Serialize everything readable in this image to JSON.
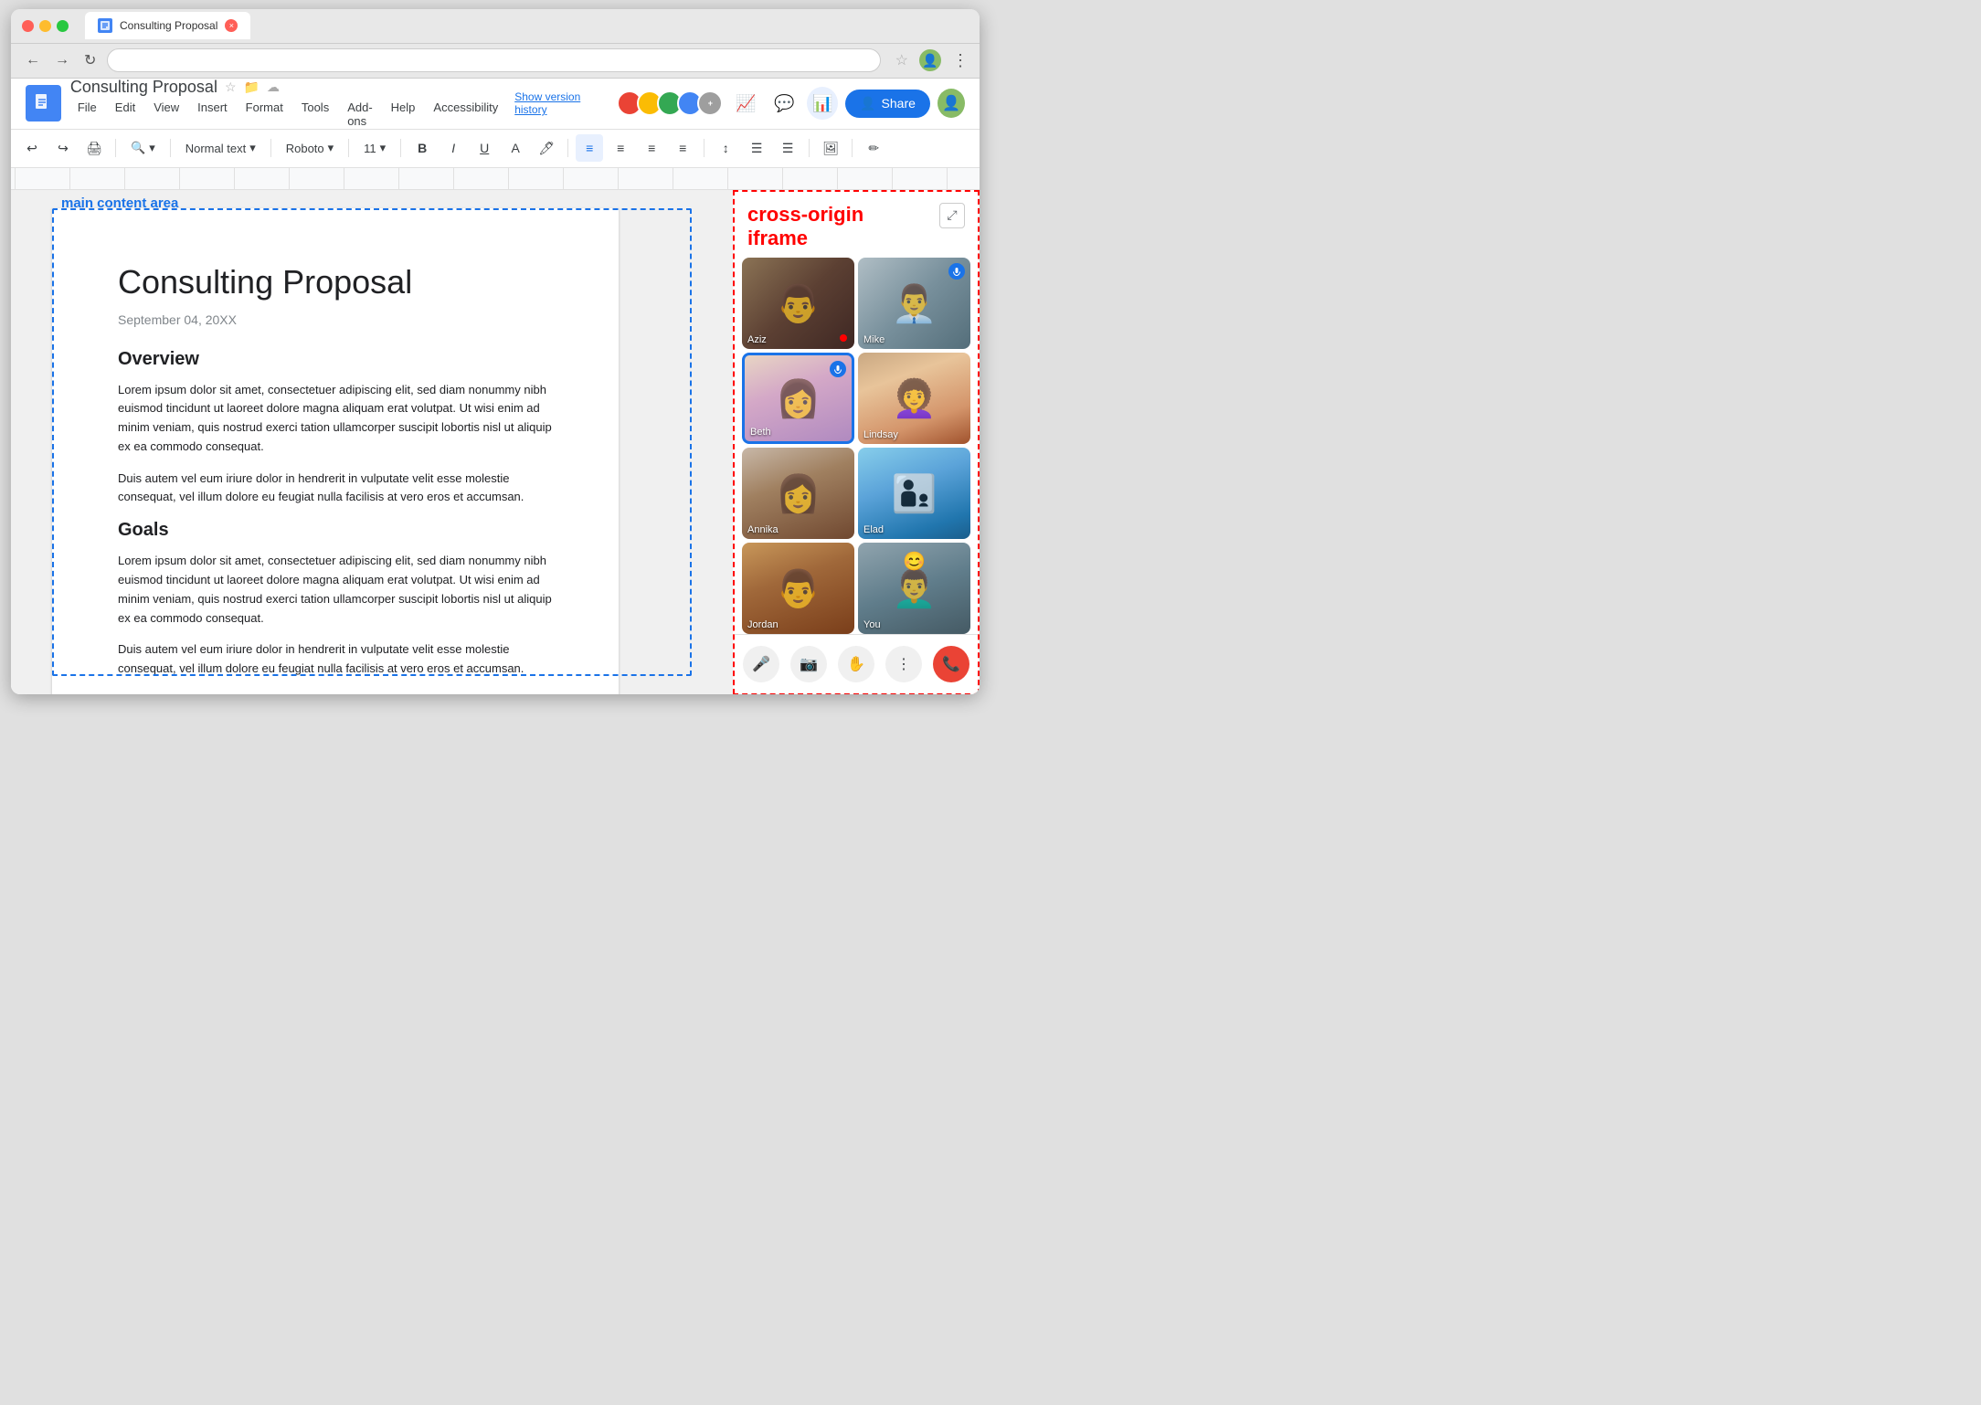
{
  "browser": {
    "tab_title": "Consulting Proposal",
    "tab_close": "×",
    "nav_back": "←",
    "nav_forward": "→",
    "nav_refresh": "↻",
    "address_bar_value": "",
    "star_icon": "☆",
    "menu_icon": "⋮"
  },
  "docs": {
    "icon": "📄",
    "title": "Consulting Proposal",
    "star_icon": "☆",
    "folder_icon": "📁",
    "cloud_icon": "☁",
    "menu_items": [
      "File",
      "Edit",
      "View",
      "Insert",
      "Format",
      "Tools",
      "Add-ons",
      "Help",
      "Accessibility"
    ],
    "version_history": "Show version history",
    "toolbar": {
      "undo": "↩",
      "redo": "↪",
      "print": "🖨",
      "zoom": "🔍",
      "normal_text": "Normal text",
      "font": "Roboto",
      "font_size": "11",
      "bold": "B",
      "italic": "I",
      "underline": "U",
      "text_color": "A",
      "highlight": "🖊",
      "align_left": "≡",
      "align_center": "≡",
      "align_right": "≡",
      "justify": "≡",
      "line_spacing": "↕",
      "bullet_list": "☰",
      "numbered_list": "☰",
      "insert_image": "🖼"
    },
    "main_content_label": "main content area",
    "page": {
      "title": "Consulting Proposal",
      "date": "September 04, 20XX",
      "overview_heading": "Overview",
      "overview_text1": "Lorem ipsum dolor sit amet, consectetuer adipiscing elit, sed diam nonummy nibh euismod tincidunt ut laoreet dolore magna aliquam erat volutpat. Ut wisi enim ad minim veniam, quis nostrud exerci tation ullamcorper suscipit lobortis nisl ut aliquip ex ea commodo consequat.",
      "overview_text2": "Duis autem vel eum iriure dolor in hendrerit in vulputate velit esse molestie consequat, vel illum dolore eu feugiat nulla facilisis at vero eros et accumsan.",
      "goals_heading": "Goals",
      "goals_text1": "Lorem ipsum dolor sit amet, consectetuer adipiscing elit, sed diam nonummy nibh euismod tincidunt ut laoreet dolore magna aliquam erat volutpat. Ut wisi enim ad minim veniam, quis nostrud exerci tation ullamcorper suscipit lobortis nisl ut aliquip ex ea commodo consequat.",
      "goals_text2": "Duis autem vel eum iriure dolor in hendrerit in vulputate velit esse molestie consequat, vel illum dolore eu feugiat nulla facilisis at vero eros et accumsan."
    }
  },
  "sidebar": {
    "title": "cross-origin\niframe",
    "expand_icon": "⤢",
    "participants": [
      {
        "name": "Aziz",
        "bg_class": "bg-aziz",
        "active_speaker": false,
        "emoji": null
      },
      {
        "name": "Mike",
        "bg_class": "bg-mike",
        "active_speaker": false,
        "speaking_icon": true,
        "emoji": null
      },
      {
        "name": "Beth",
        "bg_class": "bg-beth",
        "active_speaker": true,
        "speaking_icon": true,
        "emoji": null
      },
      {
        "name": "Lindsay",
        "bg_class": "bg-lindsay",
        "active_speaker": false,
        "emoji": null
      },
      {
        "name": "Annika",
        "bg_class": "bg-annika",
        "active_speaker": false,
        "emoji": null
      },
      {
        "name": "Elad",
        "bg_class": "bg-elad",
        "active_speaker": false,
        "emoji": null
      },
      {
        "name": "Jordan",
        "bg_class": "bg-jordan",
        "active_speaker": false,
        "emoji": null
      },
      {
        "name": "You",
        "bg_class": "bg-you",
        "active_speaker": false,
        "emoji": "😊"
      }
    ],
    "controls": {
      "mic": "🎤",
      "camera": "📹",
      "hand": "✋",
      "more": "⋮",
      "end_call": "📞"
    }
  },
  "collaborators": {
    "colors": [
      "#ea4335",
      "#fbbc04",
      "#34a853",
      "#4285f4"
    ],
    "count": 4
  }
}
